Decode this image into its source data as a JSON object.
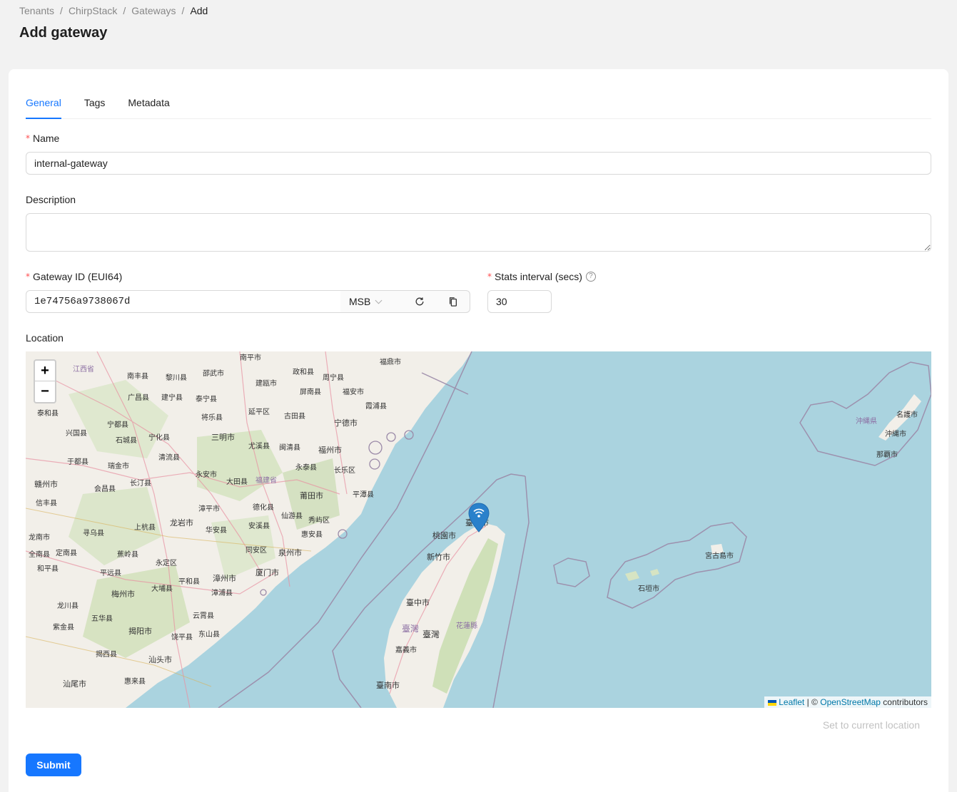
{
  "breadcrumb": [
    "Tenants",
    "ChirpStack",
    "Gateways",
    "Add"
  ],
  "page_title": "Add gateway",
  "tabs": [
    "General",
    "Tags",
    "Metadata"
  ],
  "form": {
    "name_label": "Name",
    "name_value": "internal-gateway",
    "description_label": "Description",
    "description_value": "",
    "gateway_id_label": "Gateway ID (EUI64)",
    "gateway_id_value": "1e74756a9738067d",
    "byte_order": "MSB",
    "stats_label": "Stats interval (secs)",
    "stats_value": "30",
    "location_label": "Location",
    "set_location": "Set to current location",
    "submit": "Submit"
  },
  "map": {
    "zoom_in": "+",
    "zoom_out": "−",
    "attribution_leaflet": "Leaflet",
    "attribution_sep": "| ©",
    "attribution_osm": "OpenStreetMap",
    "attribution_suffix": "contributors",
    "labels": [
      "江西省",
      "南丰县",
      "黎川县",
      "邵武市",
      "南平市",
      "政和县",
      "周宁县",
      "福鼎市",
      "广昌县",
      "建宁县",
      "泰宁县",
      "建瓯市",
      "屏南县",
      "福安市",
      "霞浦县",
      "泰和县",
      "宁都县",
      "将乐县",
      "延平区",
      "古田县",
      "宁德市",
      "兴国县",
      "石城县",
      "宁化县",
      "三明市",
      "尤溪县",
      "闽清县",
      "福州市",
      "清流县",
      "于都县",
      "瑞金市",
      "永安市",
      "永泰县",
      "长乐区",
      "赣州市",
      "会昌县",
      "长汀县",
      "大田县",
      "福建省",
      "平潭县",
      "莆田市",
      "信丰县",
      "漳平市",
      "德化县",
      "仙游县",
      "秀屿区",
      "上杭县",
      "龙岩市",
      "安溪县",
      "惠安县",
      "龙南市",
      "寻乌县",
      "华安县",
      "全南县",
      "定南县",
      "蕉岭县",
      "同安区",
      "泉州市",
      "永定区",
      "和平县",
      "平远县",
      "平和县",
      "漳州市",
      "厦门市",
      "梅州市",
      "大埔县",
      "漳浦县",
      "龙川县",
      "五华县",
      "云霄县",
      "紫金县",
      "揭阳市",
      "饶平县",
      "东山县",
      "揭西县",
      "汕头市",
      "惠来县",
      "汕尾市",
      "桃園市",
      "臺北市",
      "新竹市",
      "臺中市",
      "臺灣",
      "花蓮縣",
      "嘉義市",
      "臺南市",
      "沖縄県",
      "名護市",
      "沖縄市",
      "那覇市",
      "宮古島市",
      "石垣市"
    ]
  },
  "colors": {
    "primary": "#1677ff",
    "required": "#ff4d4f",
    "sea": "#aad3df",
    "land": "#f2efe9",
    "marker": "#2a81cb"
  }
}
